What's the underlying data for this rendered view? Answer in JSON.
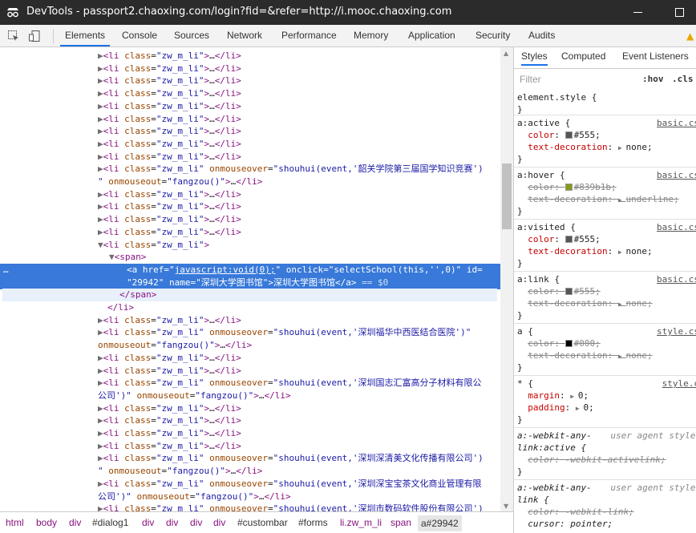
{
  "window": {
    "title": "DevTools - passport2.chaoxing.com/login?fid=&refer=http://i.mooc.chaoxing.com"
  },
  "toolbar": {
    "tabs": [
      "Elements",
      "Console",
      "Sources",
      "Network",
      "Performance",
      "Memory",
      "Application",
      "Security",
      "Audits"
    ],
    "active_tab": "Elements"
  },
  "dom": {
    "zw": "zw_m_li",
    "ev_shouhui": "shouhui(event,'",
    "ev_fangzou": "fangzou()",
    "names": {
      "shaoguan": "韶关学院第三届国学知识竞赛",
      "shenzhen_tcm": "深圳福华中西医结合医院",
      "polymer": "深圳国志汇富高分子材料有限公",
      "culture": "深圳深清美文化传播有限公司",
      "tea": "深圳深宝宝茶文化商业管理有限",
      "software": "深圳市数码软件股份有限公司"
    },
    "company_tail": "公司",
    "link_href": "javascript:void(0);",
    "link_onclick": "selectSchool(this,'',0)",
    "link_id": "29942",
    "link_name": "深圳大学图书馆",
    "link_text": "深圳大学图书馆",
    "dollar_ref": " == $0"
  },
  "breadcrumb": [
    "html",
    "body",
    "div",
    "#dialog1",
    "div",
    "div",
    "div",
    "div",
    "#custombar",
    "#forms",
    "li.zw_m_li",
    "span",
    "a#29942"
  ],
  "styles": {
    "tabs": [
      "Styles",
      "Computed",
      "Event Listeners"
    ],
    "filter_placeholder": "Filter",
    "hov": ":hov",
    "cls": ".cls",
    "element_style": "element.style {",
    "close_brace": "}",
    "rules": [
      {
        "selector": "a:active {",
        "source": "basic.cs",
        "decls": [
          {
            "prop": "color",
            "val": "#555",
            "color": "#555555",
            "struck": false
          },
          {
            "prop": "text-decoration",
            "val": "none",
            "struck": false,
            "arrow": true
          }
        ]
      },
      {
        "selector": "a:hover {",
        "source": "basic.cs",
        "decls": [
          {
            "prop": "color",
            "val": "#839b1b",
            "color": "#839b1b",
            "struck": true
          },
          {
            "prop": "text-decoration",
            "val": "underline",
            "struck": true,
            "arrow": true
          }
        ]
      },
      {
        "selector": "a:visited {",
        "source": "basic.cs",
        "decls": [
          {
            "prop": "color",
            "val": "#555",
            "color": "#555555",
            "struck": false
          },
          {
            "prop": "text-decoration",
            "val": "none",
            "struck": false,
            "arrow": true
          }
        ]
      },
      {
        "selector": "a:link {",
        "source": "basic.cs",
        "decls": [
          {
            "prop": "color",
            "val": "#555",
            "color": "#555555",
            "struck": true
          },
          {
            "prop": "text-decoration",
            "val": "none",
            "struck": true,
            "arrow": true
          }
        ]
      },
      {
        "selector": "a {",
        "source": "style.cs",
        "decls": [
          {
            "prop": "color",
            "val": "#000",
            "color": "#000000",
            "struck": true
          },
          {
            "prop": "text-decoration",
            "val": "none",
            "struck": true,
            "arrow": true
          }
        ]
      },
      {
        "selector": "* {",
        "source": "style.c",
        "decls": [
          {
            "prop": "margin",
            "val": "0",
            "struck": false,
            "arrow": true
          },
          {
            "prop": "padding",
            "val": "0",
            "struck": false,
            "arrow": true
          }
        ]
      }
    ],
    "ua1": {
      "selector1": "a:-webkit-any-",
      "selector2": "link:active {",
      "source": "user agent styles",
      "decl": "color: -webkit-activelink;"
    },
    "ua2": {
      "selector1": "a:-webkit-any-",
      "selector2": "link {",
      "source": "user agent styles",
      "decl1": "color: -webkit-link;",
      "decl2": "cursor: pointer;"
    }
  },
  "colors": {
    "accent": "#1a73e8",
    "selected": "#3879d9",
    "tag": "#881280",
    "attr": "#994500",
    "value": "#1a1aa6"
  }
}
